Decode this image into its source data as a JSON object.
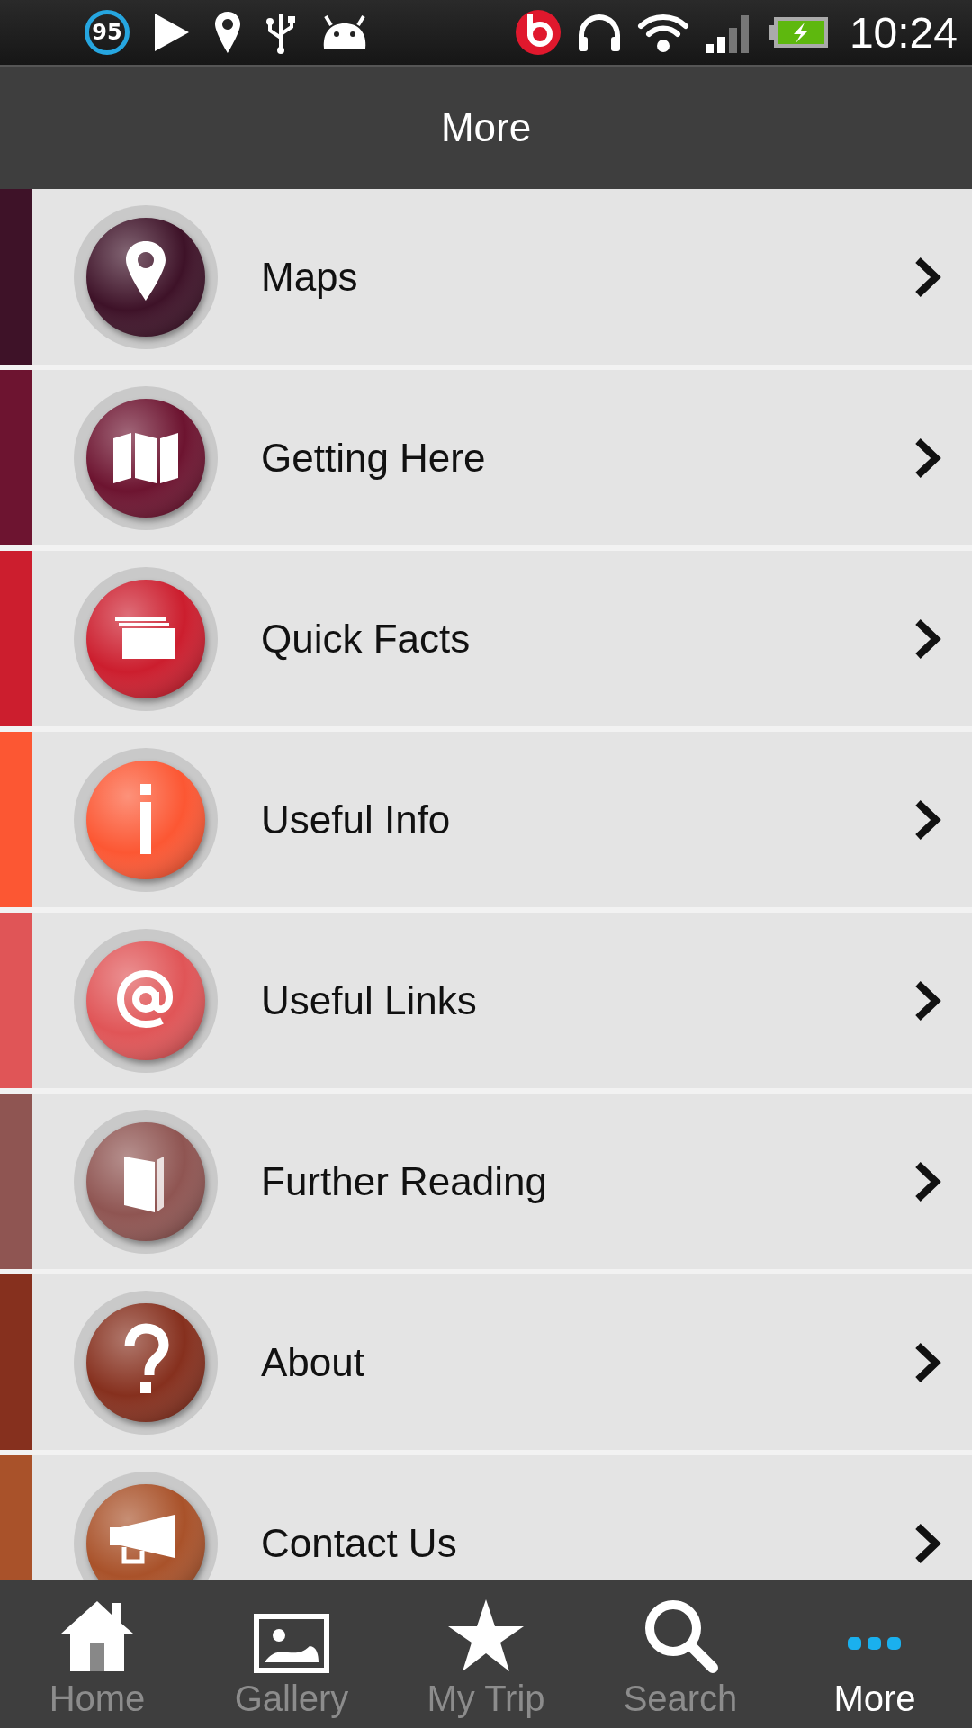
{
  "status_bar": {
    "badge": "95",
    "time": "10:24"
  },
  "header": {
    "title": "More"
  },
  "menu_items": [
    {
      "label": "Maps",
      "kind": "pin",
      "color": "#3e1228"
    },
    {
      "label": "Getting Here",
      "kind": "map",
      "color": "#6d1430"
    },
    {
      "label": "Quick Facts",
      "kind": "facts",
      "color": "#cc1e2e"
    },
    {
      "label": "Useful Info",
      "kind": "info",
      "color": "#fc5733"
    },
    {
      "label": "Useful Links",
      "kind": "at",
      "color": "#e05557"
    },
    {
      "label": "Further Reading",
      "kind": "book",
      "color": "#8f5552"
    },
    {
      "label": "About",
      "kind": "question",
      "color": "#86301e"
    },
    {
      "label": "Contact Us",
      "kind": "megaphone",
      "color": "#a9522a"
    }
  ],
  "tab_bar": [
    {
      "label": "Home",
      "kind": "home",
      "selected": false
    },
    {
      "label": "Gallery",
      "kind": "gallery",
      "selected": false
    },
    {
      "label": "My Trip",
      "kind": "star",
      "selected": false
    },
    {
      "label": "Search",
      "kind": "search",
      "selected": false
    },
    {
      "label": "More",
      "kind": "dots",
      "selected": true
    }
  ]
}
